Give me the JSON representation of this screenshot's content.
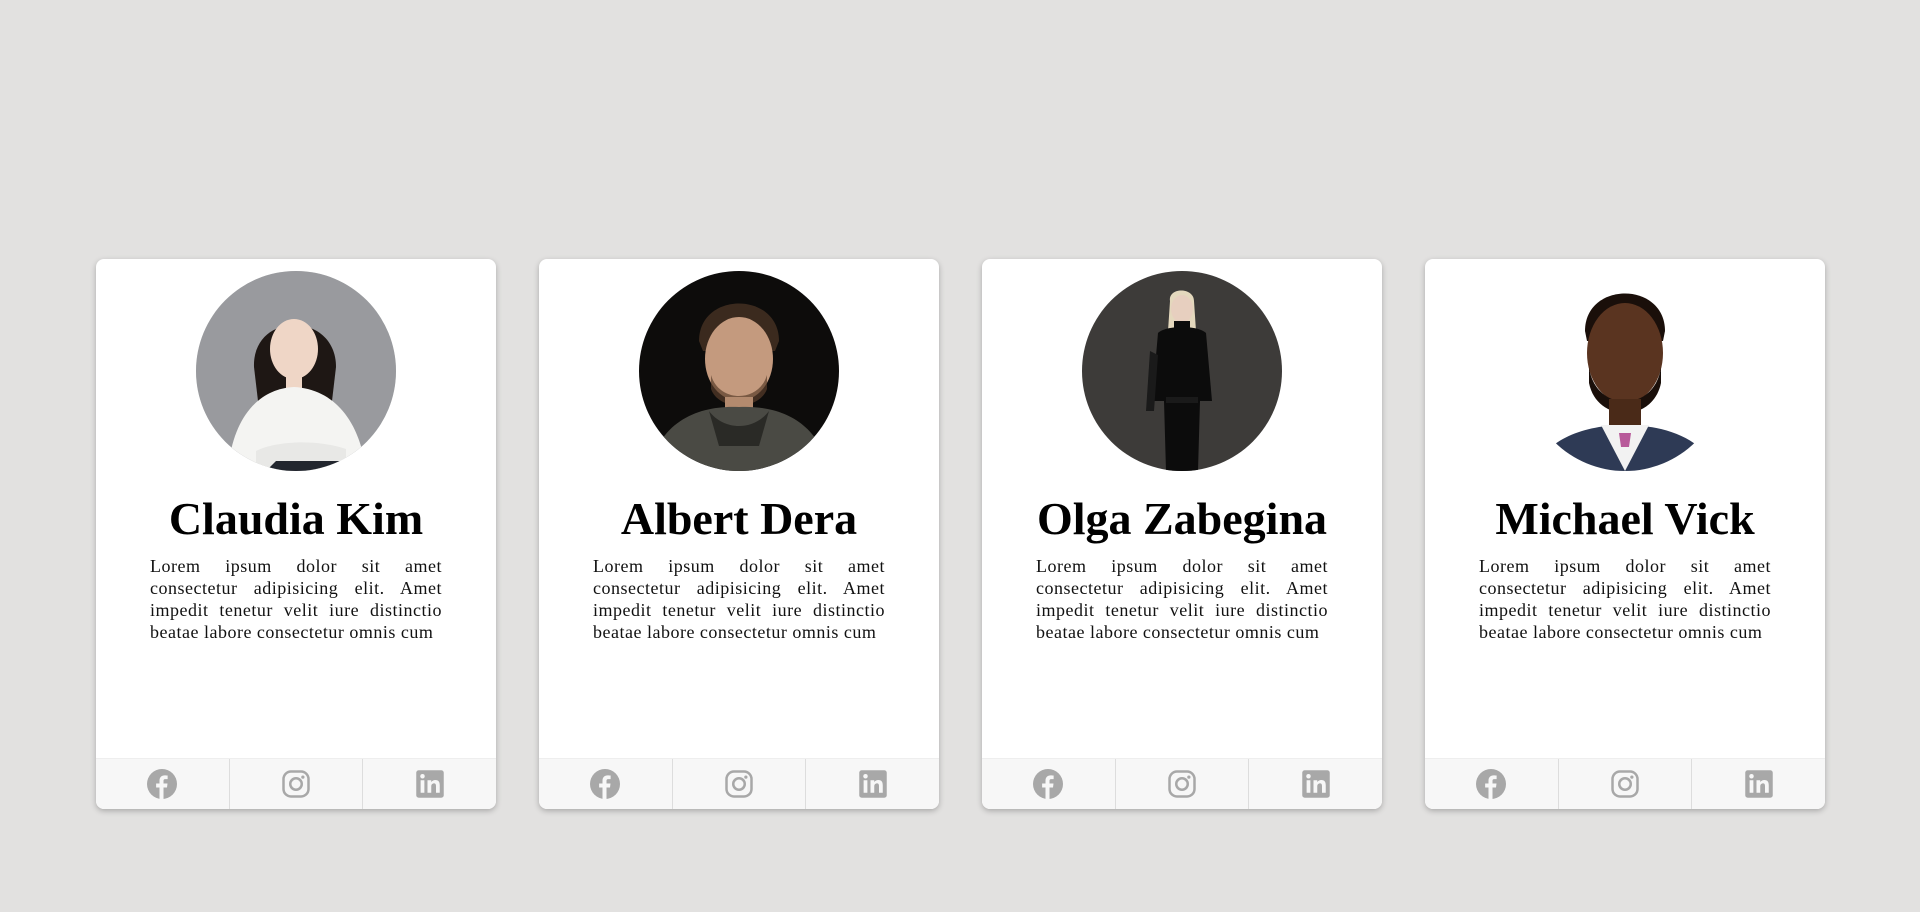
{
  "cards": [
    {
      "name": "Claudia Kim",
      "bio": "Lorem ipsum dolor sit amet consectetur adipisicing elit. Amet impedit tenetur velit iure distinctio beatae labore consectetur omnis cum",
      "photo": {
        "bg": "#8a8b8f",
        "skin": "#efd6c6",
        "hair": "#1e1714",
        "outfit": "#f4f4f2",
        "dark": "#22262e"
      }
    },
    {
      "name": "Albert Dera",
      "bio": "Lorem ipsum dolor sit amet consectetur adipisicing elit. Amet impedit tenetur velit iure distinctio beatae labore consectetur omnis cum",
      "photo": {
        "bg": "#0d0c0b",
        "skin": "#c49a7e",
        "hair": "#3b2a1e",
        "outfit": "#4a4a44",
        "dark": "#2a2a26"
      }
    },
    {
      "name": "Olga Zabegina",
      "bio": "Lorem ipsum dolor sit amet consectetur adipisicing elit. Amet impedit tenetur velit iure distinctio beatae labore consectetur omnis cum",
      "photo": {
        "bg": "#3d3b39",
        "skin": "#e7cfbf",
        "hair": "#e4d8bd",
        "outfit": "#0c0c0c",
        "dark": "#1a1a1a"
      }
    },
    {
      "name": "Michael Vick",
      "bio": "Lorem ipsum dolor sit amet consectetur adipisicing elit. Amet impedit tenetur velit iure distinctio beatae labore consectetur omnis cum",
      "photo": {
        "bg": "#ffffff",
        "skin": "#5a3420",
        "hair": "#1a0f0a",
        "outfit": "#2e3a55",
        "dark": "#1a0f0a"
      }
    }
  ],
  "social_icons": [
    "facebook-icon",
    "instagram-icon",
    "linkedin-icon"
  ],
  "colors": {
    "page_bg": "#e2e1e0",
    "card_bg": "#ffffff",
    "footer_bg": "#f7f7f7",
    "icon": "#a8a8a8"
  }
}
